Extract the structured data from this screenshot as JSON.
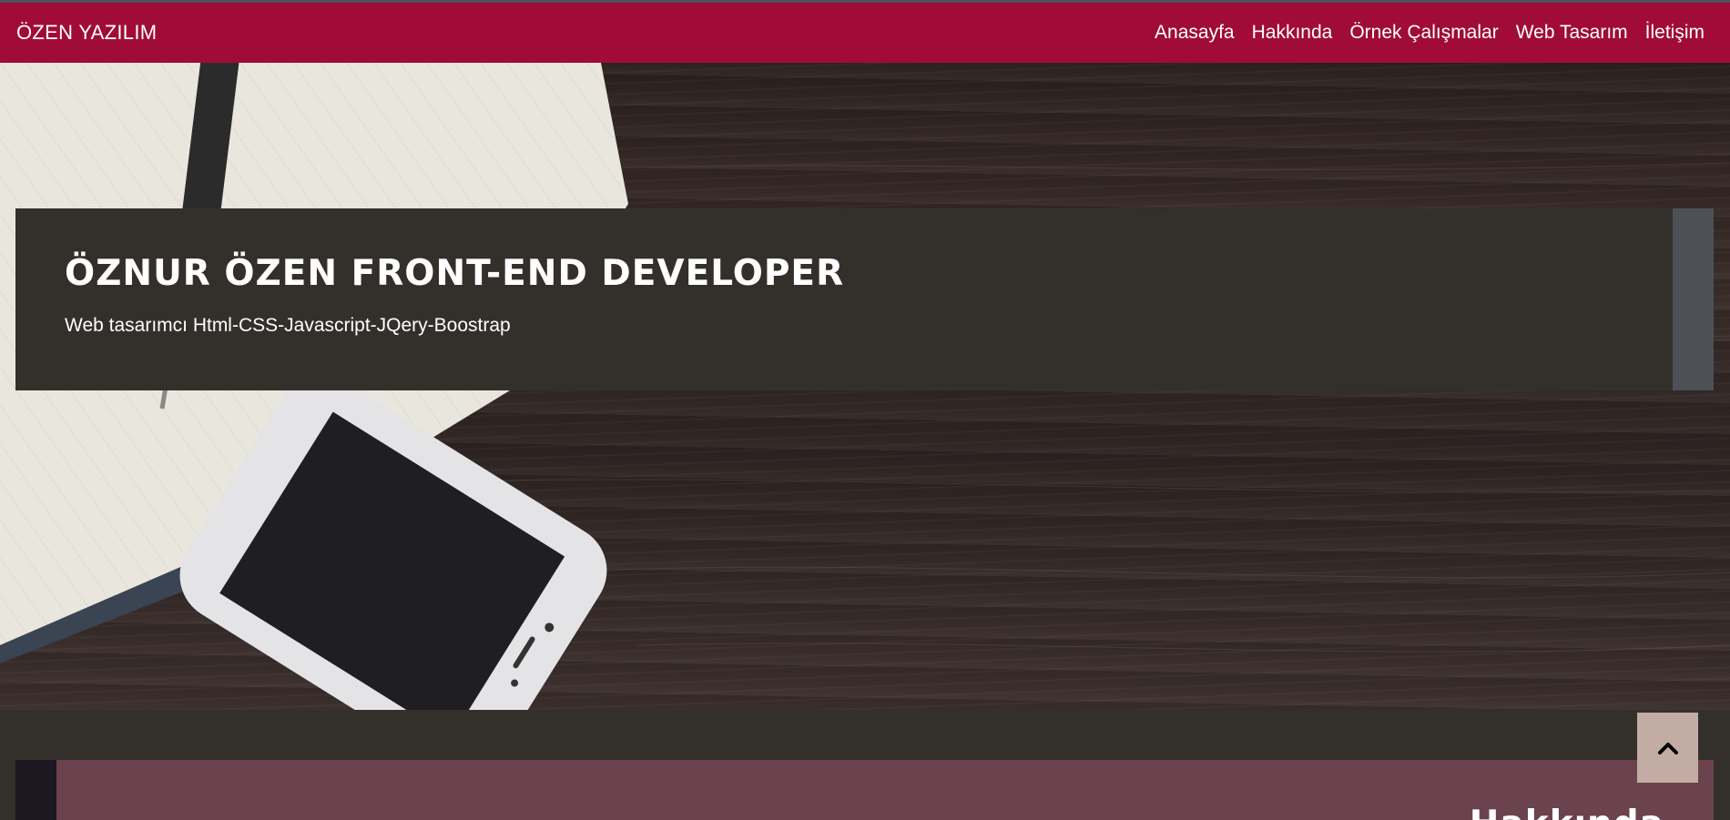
{
  "navbar": {
    "brand": "ÖZEN YAZILIM",
    "links": [
      "Anasayfa",
      "Hakkında",
      "Örnek Çalışmalar",
      "Web Tasarım",
      "İletişim"
    ]
  },
  "hero": {
    "title": "ÖZNUR ÖZEN FRONT-END DEVELOPER",
    "subtitle": "Web tasarımcı Html-CSS-Javascript-JQery-Boostrap"
  },
  "about": {
    "title": "Hakkında"
  },
  "icons": {
    "back_to_top": "chevron-up-icon"
  },
  "colors": {
    "navbar": "#a00c37",
    "banner": "#33302c",
    "banner_side": "#4d5156",
    "about_card": "#6a434f",
    "to_top": "#c3aca4"
  }
}
